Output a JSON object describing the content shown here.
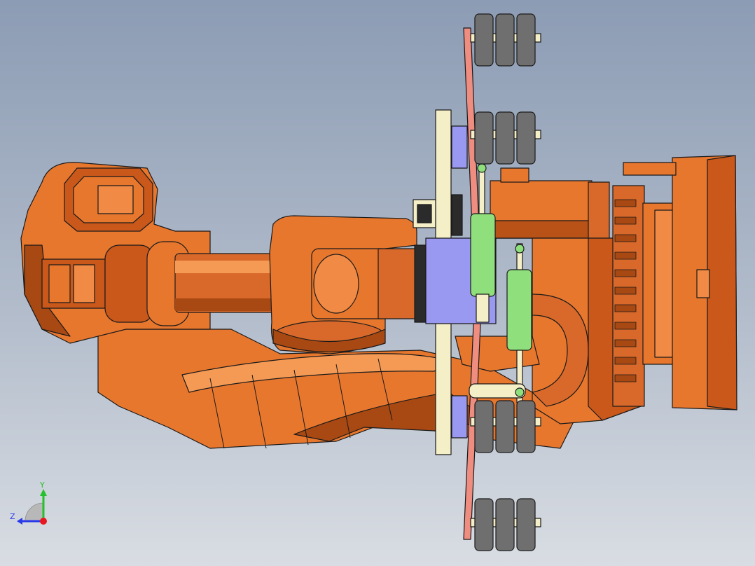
{
  "viewport": {
    "background_top": "#8c9cb4",
    "background_bottom": "#d9dde3"
  },
  "model": {
    "body_color": "#e8772e",
    "body_shadow": "#a84812",
    "body_highlight": "#f59a55",
    "tool_plate_color": "#f5efc8",
    "adapter_color": "#9a99f2",
    "cylinder_color": "#8fe07c",
    "guide_rail_color": "#ef8d80",
    "roller_color": "#6f6f6f",
    "outline_color": "#1a1a1a"
  },
  "triad": {
    "y_label": "Y",
    "z_label": "Z",
    "x_color": "#e8161e",
    "y_color": "#25c12d",
    "z_color": "#2a3ae8",
    "icon": "coordinate-triad-icon"
  }
}
